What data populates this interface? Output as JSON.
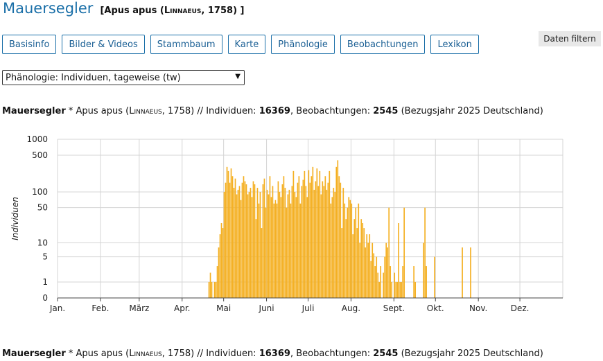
{
  "header": {
    "species_de": "Mauersegler",
    "sci_prefix": "[Apus apus (",
    "sci_author": "Linnaeus",
    "sci_suffix": ", 1758) ]"
  },
  "nav": [
    "Basisinfo",
    "Bilder & Videos",
    "Stammbaum",
    "Karte",
    "Phänologie",
    "Beobachtungen",
    "Lexikon"
  ],
  "filter_label": "Daten filtern",
  "select_value": "Phänologie: Individuen, tageweise (tw)",
  "summary": {
    "species": "Mauersegler",
    "sci_pre": " * Apus apus (",
    "author": "Linnaeus",
    "year_part": ", 1758) // Individuen: ",
    "individuals": "16369",
    "obs_label": ", Beobachtungen: ",
    "observations": "2545",
    "ref": " (Bezugsjahr 2025 Deutschland)"
  },
  "chart_data": {
    "type": "bar",
    "ylabel": "Individuen",
    "y_scale": "log(1+y)",
    "y_ticks": [
      0,
      1,
      5,
      10,
      50,
      100,
      500,
      1000
    ],
    "grid": true,
    "bar_color": "#f4b023",
    "months": [
      "Jan.",
      "Feb.",
      "März",
      "Apr.",
      "Mai",
      "Juni",
      "Juli",
      "Aug.",
      "Sept.",
      "Okt.",
      "Nov.",
      "Dez."
    ],
    "bars": [
      [
        "04-20",
        1
      ],
      [
        "04-21",
        2
      ],
      [
        "04-22",
        1
      ],
      [
        "04-24",
        1
      ],
      [
        "04-25",
        1
      ],
      [
        "04-26",
        3
      ],
      [
        "04-27",
        8
      ],
      [
        "04-28",
        15
      ],
      [
        "04-29",
        25
      ],
      [
        "04-30",
        20
      ],
      [
        "05-01",
        100
      ],
      [
        "05-02",
        150
      ],
      [
        "05-03",
        300
      ],
      [
        "05-04",
        250
      ],
      [
        "05-05",
        150
      ],
      [
        "05-06",
        280
      ],
      [
        "05-07",
        200
      ],
      [
        "05-08",
        120
      ],
      [
        "05-09",
        180
      ],
      [
        "05-10",
        90
      ],
      [
        "05-11",
        110
      ],
      [
        "05-12",
        130
      ],
      [
        "05-13",
        70
      ],
      [
        "05-14",
        150
      ],
      [
        "05-15",
        200
      ],
      [
        "05-16",
        160
      ],
      [
        "05-17",
        140
      ],
      [
        "05-18",
        90
      ],
      [
        "05-19",
        100
      ],
      [
        "05-20",
        120
      ],
      [
        "05-21",
        80
      ],
      [
        "05-22",
        160
      ],
      [
        "05-23",
        140
      ],
      [
        "05-24",
        30
      ],
      [
        "05-25",
        120
      ],
      [
        "05-26",
        60
      ],
      [
        "05-27",
        100
      ],
      [
        "05-28",
        20
      ],
      [
        "05-29",
        140
      ],
      [
        "05-30",
        180
      ],
      [
        "05-31",
        50
      ],
      [
        "06-01",
        110
      ],
      [
        "06-02",
        90
      ],
      [
        "06-03",
        200
      ],
      [
        "06-04",
        80
      ],
      [
        "06-05",
        130
      ],
      [
        "06-06",
        60
      ],
      [
        "06-07",
        70
      ],
      [
        "06-08",
        60
      ],
      [
        "06-09",
        160
      ],
      [
        "06-10",
        100
      ],
      [
        "06-11",
        80
      ],
      [
        "06-12",
        140
      ],
      [
        "06-13",
        200
      ],
      [
        "06-14",
        120
      ],
      [
        "06-15",
        50
      ],
      [
        "06-16",
        90
      ],
      [
        "06-17",
        110
      ],
      [
        "06-18",
        60
      ],
      [
        "06-19",
        130
      ],
      [
        "06-20",
        250
      ],
      [
        "06-21",
        100
      ],
      [
        "06-22",
        80
      ],
      [
        "06-23",
        150
      ],
      [
        "06-24",
        200
      ],
      [
        "06-25",
        60
      ],
      [
        "06-26",
        130
      ],
      [
        "06-27",
        170
      ],
      [
        "06-28",
        250
      ],
      [
        "06-29",
        130
      ],
      [
        "06-30",
        80
      ],
      [
        "07-01",
        260
      ],
      [
        "07-02",
        150
      ],
      [
        "07-03",
        200
      ],
      [
        "07-04",
        300
      ],
      [
        "07-05",
        110
      ],
      [
        "07-06",
        160
      ],
      [
        "07-07",
        280
      ],
      [
        "07-08",
        130
      ],
      [
        "07-09",
        250
      ],
      [
        "07-10",
        90
      ],
      [
        "07-11",
        160
      ],
      [
        "07-12",
        130
      ],
      [
        "07-13",
        200
      ],
      [
        "07-14",
        110
      ],
      [
        "07-15",
        150
      ],
      [
        "07-16",
        250
      ],
      [
        "07-17",
        60
      ],
      [
        "07-18",
        80
      ],
      [
        "07-19",
        120
      ],
      [
        "07-20",
        100
      ],
      [
        "07-21",
        300
      ],
      [
        "07-22",
        400
      ],
      [
        "07-23",
        200
      ],
      [
        "07-24",
        150
      ],
      [
        "07-25",
        20
      ],
      [
        "07-26",
        120
      ],
      [
        "07-27",
        60
      ],
      [
        "07-28",
        30
      ],
      [
        "07-29",
        50
      ],
      [
        "07-30",
        80
      ],
      [
        "07-31",
        70
      ],
      [
        "08-01",
        60
      ],
      [
        "08-02",
        15
      ],
      [
        "08-03",
        30
      ],
      [
        "08-04",
        50
      ],
      [
        "08-05",
        20
      ],
      [
        "08-06",
        60
      ],
      [
        "08-07",
        10
      ],
      [
        "08-08",
        30
      ],
      [
        "08-09",
        25
      ],
      [
        "08-10",
        20
      ],
      [
        "08-11",
        8
      ],
      [
        "08-12",
        15
      ],
      [
        "08-13",
        10
      ],
      [
        "08-14",
        15
      ],
      [
        "08-15",
        4
      ],
      [
        "08-16",
        10
      ],
      [
        "08-17",
        6
      ],
      [
        "08-18",
        3
      ],
      [
        "08-19",
        5
      ],
      [
        "08-20",
        2
      ],
      [
        "08-21",
        1
      ],
      [
        "08-22",
        3
      ],
      [
        "08-24",
        2
      ],
      [
        "08-25",
        5
      ],
      [
        "08-26",
        10
      ],
      [
        "08-27",
        8
      ],
      [
        "08-28",
        50
      ],
      [
        "08-29",
        3
      ],
      [
        "08-30",
        1
      ],
      [
        "09-01",
        2
      ],
      [
        "09-02",
        1
      ],
      [
        "09-03",
        1
      ],
      [
        "09-04",
        25
      ],
      [
        "09-05",
        1
      ],
      [
        "09-06",
        1
      ],
      [
        "09-07",
        3
      ],
      [
        "09-08",
        50
      ],
      [
        "09-15",
        3
      ],
      [
        "09-16",
        1
      ],
      [
        "09-22",
        10
      ],
      [
        "09-23",
        50
      ],
      [
        "09-24",
        3
      ],
      [
        "09-30",
        5
      ],
      [
        "10-20",
        8
      ],
      [
        "10-26",
        8
      ]
    ]
  }
}
